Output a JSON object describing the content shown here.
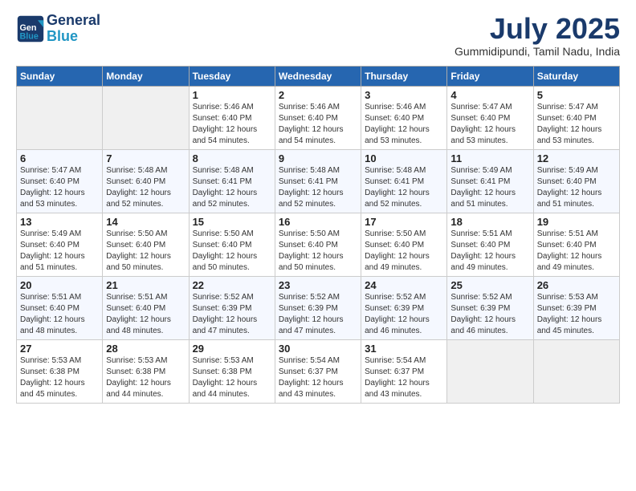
{
  "header": {
    "logo_line1": "General",
    "logo_line2": "Blue",
    "month_title": "July 2025",
    "location": "Gummidipundi, Tamil Nadu, India"
  },
  "weekdays": [
    "Sunday",
    "Monday",
    "Tuesday",
    "Wednesday",
    "Thursday",
    "Friday",
    "Saturday"
  ],
  "weeks": [
    [
      {
        "day": "",
        "info": ""
      },
      {
        "day": "",
        "info": ""
      },
      {
        "day": "1",
        "info": "Sunrise: 5:46 AM\nSunset: 6:40 PM\nDaylight: 12 hours and 54 minutes."
      },
      {
        "day": "2",
        "info": "Sunrise: 5:46 AM\nSunset: 6:40 PM\nDaylight: 12 hours and 54 minutes."
      },
      {
        "day": "3",
        "info": "Sunrise: 5:46 AM\nSunset: 6:40 PM\nDaylight: 12 hours and 53 minutes."
      },
      {
        "day": "4",
        "info": "Sunrise: 5:47 AM\nSunset: 6:40 PM\nDaylight: 12 hours and 53 minutes."
      },
      {
        "day": "5",
        "info": "Sunrise: 5:47 AM\nSunset: 6:40 PM\nDaylight: 12 hours and 53 minutes."
      }
    ],
    [
      {
        "day": "6",
        "info": "Sunrise: 5:47 AM\nSunset: 6:40 PM\nDaylight: 12 hours and 53 minutes."
      },
      {
        "day": "7",
        "info": "Sunrise: 5:48 AM\nSunset: 6:40 PM\nDaylight: 12 hours and 52 minutes."
      },
      {
        "day": "8",
        "info": "Sunrise: 5:48 AM\nSunset: 6:41 PM\nDaylight: 12 hours and 52 minutes."
      },
      {
        "day": "9",
        "info": "Sunrise: 5:48 AM\nSunset: 6:41 PM\nDaylight: 12 hours and 52 minutes."
      },
      {
        "day": "10",
        "info": "Sunrise: 5:48 AM\nSunset: 6:41 PM\nDaylight: 12 hours and 52 minutes."
      },
      {
        "day": "11",
        "info": "Sunrise: 5:49 AM\nSunset: 6:41 PM\nDaylight: 12 hours and 51 minutes."
      },
      {
        "day": "12",
        "info": "Sunrise: 5:49 AM\nSunset: 6:40 PM\nDaylight: 12 hours and 51 minutes."
      }
    ],
    [
      {
        "day": "13",
        "info": "Sunrise: 5:49 AM\nSunset: 6:40 PM\nDaylight: 12 hours and 51 minutes."
      },
      {
        "day": "14",
        "info": "Sunrise: 5:50 AM\nSunset: 6:40 PM\nDaylight: 12 hours and 50 minutes."
      },
      {
        "day": "15",
        "info": "Sunrise: 5:50 AM\nSunset: 6:40 PM\nDaylight: 12 hours and 50 minutes."
      },
      {
        "day": "16",
        "info": "Sunrise: 5:50 AM\nSunset: 6:40 PM\nDaylight: 12 hours and 50 minutes."
      },
      {
        "day": "17",
        "info": "Sunrise: 5:50 AM\nSunset: 6:40 PM\nDaylight: 12 hours and 49 minutes."
      },
      {
        "day": "18",
        "info": "Sunrise: 5:51 AM\nSunset: 6:40 PM\nDaylight: 12 hours and 49 minutes."
      },
      {
        "day": "19",
        "info": "Sunrise: 5:51 AM\nSunset: 6:40 PM\nDaylight: 12 hours and 49 minutes."
      }
    ],
    [
      {
        "day": "20",
        "info": "Sunrise: 5:51 AM\nSunset: 6:40 PM\nDaylight: 12 hours and 48 minutes."
      },
      {
        "day": "21",
        "info": "Sunrise: 5:51 AM\nSunset: 6:40 PM\nDaylight: 12 hours and 48 minutes."
      },
      {
        "day": "22",
        "info": "Sunrise: 5:52 AM\nSunset: 6:39 PM\nDaylight: 12 hours and 47 minutes."
      },
      {
        "day": "23",
        "info": "Sunrise: 5:52 AM\nSunset: 6:39 PM\nDaylight: 12 hours and 47 minutes."
      },
      {
        "day": "24",
        "info": "Sunrise: 5:52 AM\nSunset: 6:39 PM\nDaylight: 12 hours and 46 minutes."
      },
      {
        "day": "25",
        "info": "Sunrise: 5:52 AM\nSunset: 6:39 PM\nDaylight: 12 hours and 46 minutes."
      },
      {
        "day": "26",
        "info": "Sunrise: 5:53 AM\nSunset: 6:39 PM\nDaylight: 12 hours and 45 minutes."
      }
    ],
    [
      {
        "day": "27",
        "info": "Sunrise: 5:53 AM\nSunset: 6:38 PM\nDaylight: 12 hours and 45 minutes."
      },
      {
        "day": "28",
        "info": "Sunrise: 5:53 AM\nSunset: 6:38 PM\nDaylight: 12 hours and 44 minutes."
      },
      {
        "day": "29",
        "info": "Sunrise: 5:53 AM\nSunset: 6:38 PM\nDaylight: 12 hours and 44 minutes."
      },
      {
        "day": "30",
        "info": "Sunrise: 5:54 AM\nSunset: 6:37 PM\nDaylight: 12 hours and 43 minutes."
      },
      {
        "day": "31",
        "info": "Sunrise: 5:54 AM\nSunset: 6:37 PM\nDaylight: 12 hours and 43 minutes."
      },
      {
        "day": "",
        "info": ""
      },
      {
        "day": "",
        "info": ""
      }
    ]
  ]
}
